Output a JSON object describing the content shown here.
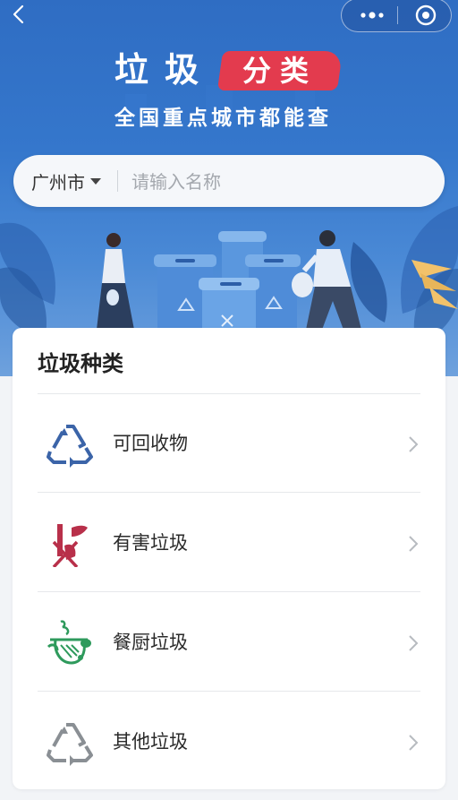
{
  "header": {
    "title_main": "垃圾",
    "title_badge": "分类",
    "subtitle": "全国重点城市都能查"
  },
  "search": {
    "city": "广州市",
    "placeholder": "请输入名称"
  },
  "categories": {
    "heading": "垃圾种类",
    "items": [
      {
        "label": "可回收物",
        "icon": "recycle-icon",
        "color": "#3b64a8"
      },
      {
        "label": "有害垃圾",
        "icon": "hazardous-icon",
        "color": "#b8304a"
      },
      {
        "label": "餐厨垃圾",
        "icon": "food-waste-icon",
        "color": "#2e9a5c"
      },
      {
        "label": "其他垃圾",
        "icon": "other-waste-icon",
        "color": "#8a8f94"
      }
    ]
  },
  "colors": {
    "header_blue": "#2f6dc3",
    "badge_red": "#e33b4e"
  }
}
